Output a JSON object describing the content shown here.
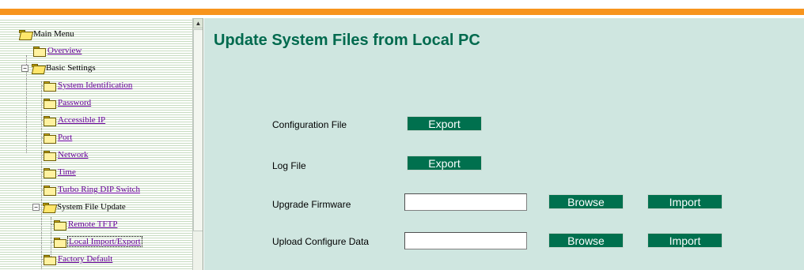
{
  "colors": {
    "accent_bar": "#f7941d",
    "title": "#006a4e",
    "button_bg": "#00704e",
    "content_bg": "#cfe6e0",
    "link": "#660099"
  },
  "tree": {
    "items": [
      {
        "label": "Main Menu",
        "link": false
      },
      {
        "label": "Overview",
        "link": true
      },
      {
        "label": "Basic Settings",
        "link": false,
        "toggle": "−"
      },
      {
        "label": "System Identification",
        "link": true
      },
      {
        "label": "Password",
        "link": true
      },
      {
        "label": "Accessible IP",
        "link": true
      },
      {
        "label": "Port",
        "link": true
      },
      {
        "label": "Network",
        "link": true
      },
      {
        "label": "Time",
        "link": true
      },
      {
        "label": "Turbo Ring DIP Switch",
        "link": true
      },
      {
        "label": "System File Update",
        "link": false,
        "toggle": "−"
      },
      {
        "label": "Remote TFTP",
        "link": true
      },
      {
        "label": "Local Import/Export",
        "link": true,
        "selected": true
      },
      {
        "label": "Factory Default",
        "link": true
      }
    ],
    "scroll_up_icon": "▲"
  },
  "main": {
    "title": "Update System Files from Local PC",
    "rows": {
      "config_file": {
        "label": "Configuration File",
        "export_label": "Export"
      },
      "log_file": {
        "label": "Log File",
        "export_label": "Export"
      },
      "upgrade_firmware": {
        "label": "Upgrade Firmware",
        "value": "",
        "browse_label": "Browse",
        "import_label": "Import"
      },
      "upload_config": {
        "label": "Upload Configure Data",
        "value": "",
        "browse_label": "Browse",
        "import_label": "Import"
      }
    }
  }
}
